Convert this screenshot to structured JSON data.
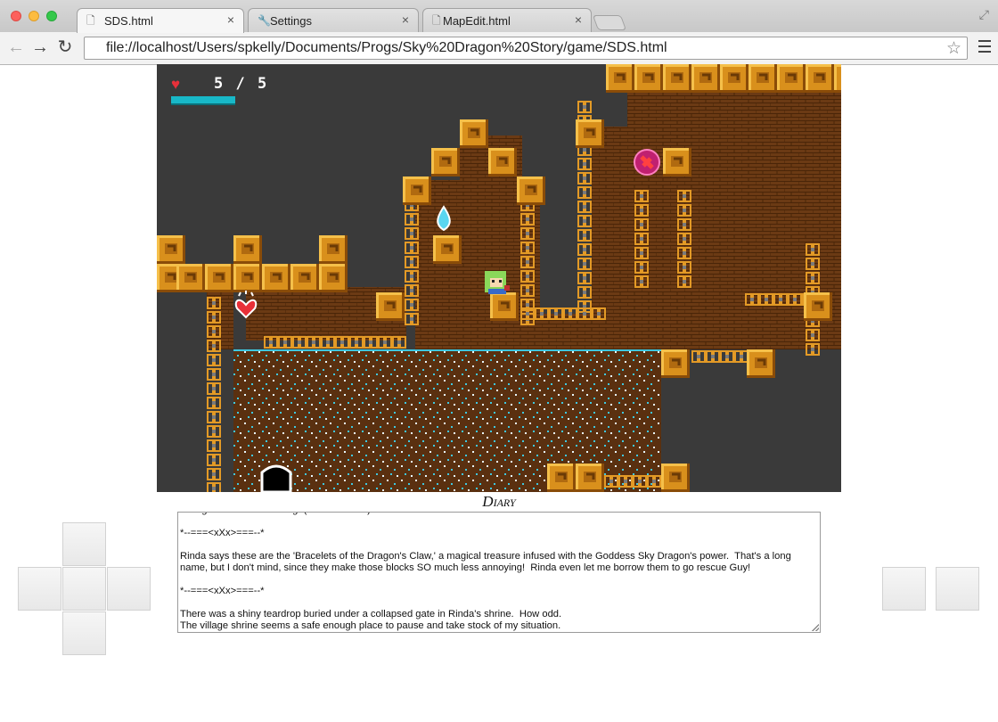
{
  "browser": {
    "tabs": [
      {
        "label": "SDS.html",
        "icon": "page-icon",
        "active": true
      },
      {
        "label": "Settings",
        "icon": "wrench-icon",
        "active": false
      },
      {
        "label": "MapEdit.html",
        "icon": "page-icon",
        "active": false
      }
    ],
    "url": "file://localhost/Users/spkelly/Documents/Progs/Sky%20Dragon%20Story/game/SDS.html"
  },
  "hud": {
    "health_text": "5 / 5",
    "health_current": 5,
    "health_max": 5,
    "energy_fraction": 1.0,
    "heart_icon": "heart-icon"
  },
  "diary": {
    "title": "Diary",
    "lines": [
      "   ----g                          ----g  (               ----  )",
      "",
      "*--===<xXx>===--*",
      "",
      "Rinda says these are the 'Bracelets of the Dragon's Claw,' a magical treasure infused with the Goddess Sky Dragon's power.  That's a long name, but I don't mind, since they make those blocks SO much less annoying!  Rinda even let me borrow them to go rescue Guy!",
      "",
      "*--===<xXx>===--*",
      "",
      "There was a shiny teardrop buried under a collapsed gate in Rinda's shrine.  How odd.",
      "The village shrine seems a safe enough place to pause and take stock of my situation."
    ]
  },
  "colors": {
    "background": "#3a3a3a",
    "brick": "#6b3a14",
    "block": "#d9901c",
    "water_edge": "#3fc8e0",
    "energy": "#18b8c8"
  }
}
